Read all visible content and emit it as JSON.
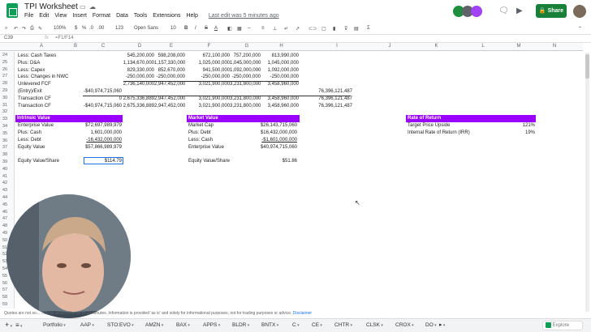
{
  "doc": {
    "title": "TPI Worksheet",
    "last_edit": "Last edit was 5 minutes ago"
  },
  "menu": [
    "File",
    "Edit",
    "View",
    "Insert",
    "Format",
    "Data",
    "Tools",
    "Extensions",
    "Help"
  ],
  "header": {
    "share": "Share"
  },
  "toolbar": {
    "zoom": "100%",
    "currency": "$",
    "percent": "%",
    "dec_dec": ".0",
    "dec_inc": ".00",
    "fmt": "123",
    "font": "Open Sans",
    "size": "10",
    "bold": "B",
    "italic": "I",
    "strike": "S",
    "textcolor": "A",
    "sum": "Σ"
  },
  "formula": {
    "cellref": "C39",
    "fx": "fx",
    "content": "=F1/F14"
  },
  "columns": [
    "A",
    "B",
    "C",
    "D",
    "E",
    "F",
    "G",
    "H",
    "I",
    "J",
    "K",
    "L",
    "M",
    "N"
  ],
  "rows": [
    "24",
    "25",
    "26",
    "27",
    "28",
    "29",
    "30",
    "31",
    "32",
    "33",
    "34",
    "35",
    "36",
    "37",
    "38",
    "39",
    "40",
    "41",
    "42",
    "43",
    "44",
    "45",
    "46",
    "47",
    "48",
    "49",
    "50",
    "51",
    "52",
    "53",
    "54",
    "55",
    "56",
    "57",
    "58",
    "59"
  ],
  "cf": {
    "labels": [
      "Less: Cash Taxes",
      "Plus: D&A",
      "Less: Capex",
      "Less: Changes in NWC",
      "Unlevered FCF",
      "(Entry)/Exit",
      "Transaction CF",
      "Transaction CF"
    ],
    "c": [
      "",
      "",
      "",
      "",
      "",
      "-$40,974,715,060",
      "0",
      "-$40,974,715,060"
    ],
    "d": [
      "545,200,000",
      "1,134,670,000",
      "829,330,000",
      "-250,000,000",
      "2,736,140,000",
      "",
      "2,675,336,889",
      "2,675,336,889"
    ],
    "e": [
      "598,208,000",
      "1,157,330,000",
      "852,670,000",
      "-250,000,000",
      "2,947,452,000",
      "",
      "2,947,452,000",
      "2,947,452,000"
    ],
    "f": [
      "672,100,000",
      "1,025,000,000",
      "941,500,000",
      "-250,000,000",
      "3,021,900,000",
      "",
      "3,021,900,000",
      "3,021,900,000"
    ],
    "g": [
      "757,200,000",
      "1,045,000,000",
      "1,092,000,000",
      "-250,000,000",
      "3,231,800,000",
      "",
      "3,231,800,000",
      "3,231,800,000"
    ],
    "h": [
      "813,990,000",
      "1,045,000,000",
      "1,092,000,000",
      "-250,000,000",
      "3,458,960,000",
      "",
      "3,458,960,000",
      "3,458,960,000"
    ],
    "i": [
      "",
      "",
      "",
      "",
      "",
      "76,396,121,487",
      "76,396,121,487",
      "76,396,121,487"
    ]
  },
  "intrinsic": {
    "title": "Intrinsic Value",
    "labels": [
      "Enterprise Value",
      "Plus: Cash",
      "Less: Debt",
      "Equity Value"
    ],
    "values": [
      "$72,697,989,979",
      "1,601,000,000",
      "-16,432,000,000",
      "$57,866,989,979"
    ],
    "eps_label": "Equity Value/Share",
    "eps_value": "$114.79"
  },
  "market": {
    "title": "Market Value",
    "labels": [
      "Market Cap",
      "Plus: Debt",
      "Less: Cash",
      "Enterprise Value"
    ],
    "values": [
      "$26,143,715,060",
      "$16,432,000,000",
      "-$1,601,000,000",
      "$40,974,715,060"
    ],
    "eps_label": "Equity Value/Share",
    "eps_value": "$51.86"
  },
  "ror": {
    "title": "Rate of Return",
    "labels": [
      "Target Price Upside",
      "Internal Rate of Return (IRR)"
    ],
    "values": [
      "121%",
      "19%"
    ]
  },
  "disclaimer": {
    "text": "Quotes are not so... ...ay be delayed by up to 20 minutes. Information is provided 'as is' and solely for informational purposes, not for trading purposes or advice.",
    "link": "Disclaimer"
  },
  "tabs": [
    "Portfolio",
    "AAP",
    "STO:EVO",
    "AMZN",
    "BAX",
    "APPS",
    "BLDR",
    "BNTX",
    "C",
    "CE",
    "CHTR",
    "CLSK",
    "CROX",
    "DO"
  ],
  "explore": "Explore",
  "colors": {
    "accent": "#9900ff",
    "share": "#188038",
    "selection": "#1a73e8"
  }
}
